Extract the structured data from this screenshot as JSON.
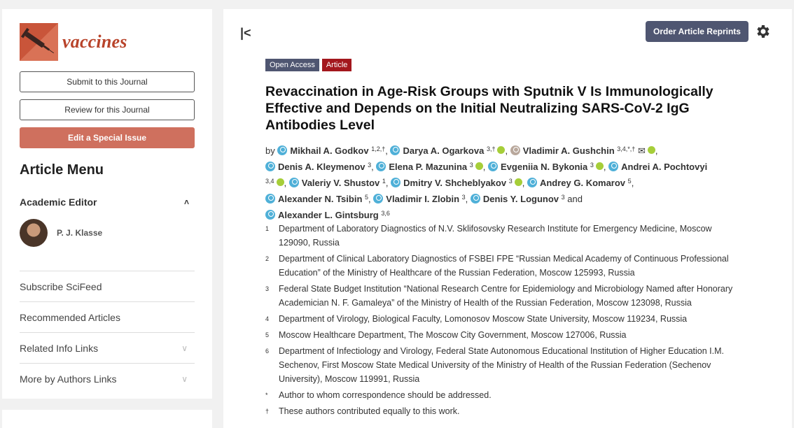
{
  "sidebar": {
    "journal_name": "vaccines",
    "buttons": {
      "submit": "Submit to this Journal",
      "review": "Review for this Journal",
      "special": "Edit a Special Issue"
    },
    "article_menu_title": "Article Menu",
    "academic_editor_label": "Academic Editor",
    "editor_name": "P. J. Klasse",
    "menu_items": [
      "Subscribe SciFeed",
      "Recommended Articles",
      "Related Info Links",
      "More by Authors Links"
    ]
  },
  "toolbar": {
    "reprints_label": "Order Article Reprints"
  },
  "article": {
    "badges": {
      "open_access": "Open Access",
      "type": "Article"
    },
    "title": "Revaccination in Age-Risk Groups with Sputnik V Is Immunologically Effective and Depends on the Initial Neutralizing SARS-CoV-2 IgG Antibodies Level",
    "by": "by",
    "and": "and",
    "authors": [
      {
        "name": "Mikhail A. Godkov",
        "sup": "1,2,†"
      },
      {
        "name": "Darya A. Ogarkova",
        "sup": "3,†"
      },
      {
        "name": "Vladimir A. Gushchin",
        "sup": "3,4,*,†"
      },
      {
        "name": "Denis A. Kleymenov",
        "sup": "3"
      },
      {
        "name": "Elena P. Mazunina",
        "sup": "3"
      },
      {
        "name": "Evgeniia N. Bykonia",
        "sup": "3"
      },
      {
        "name": "Andrei A. Pochtovyi",
        "sup": "3,4"
      },
      {
        "name": "Valeriy V. Shustov",
        "sup": "1"
      },
      {
        "name": "Dmitry V. Shcheblyakov",
        "sup": "3"
      },
      {
        "name": "Andrey G. Komarov",
        "sup": "5"
      },
      {
        "name": "Alexander N. Tsibin",
        "sup": "5"
      },
      {
        "name": "Vladimir I. Zlobin",
        "sup": "3"
      },
      {
        "name": "Denis Y. Logunov",
        "sup": "3"
      },
      {
        "name": "Alexander L. Gintsburg",
        "sup": "3,6"
      }
    ],
    "affiliations": [
      {
        "num": "1",
        "text": "Department of Laboratory Diagnostics of N.V. Sklifosovsky Research Institute for Emergency Medicine, Moscow 129090, Russia"
      },
      {
        "num": "2",
        "text": "Department of Clinical Laboratory Diagnostics of FSBEI FPE “Russian Medical Academy of Continuous Professional Education” of the Ministry of Healthcare of the Russian Federation, Moscow 125993, Russia"
      },
      {
        "num": "3",
        "text": "Federal State Budget Institution “National Research Centre for Epidemiology and Microbiology Named after Honorary Academician N. F. Gamaleya” of the Ministry of Health of the Russian Federation, Moscow 123098, Russia"
      },
      {
        "num": "4",
        "text": "Department of Virology, Biological Faculty, Lomonosov Moscow State University, Moscow 119234, Russia"
      },
      {
        "num": "5",
        "text": "Moscow Healthcare Department, The Moscow City Government, Moscow 127006, Russia"
      },
      {
        "num": "6",
        "text": "Department of Infectiology and Virology, Federal State Autonomous Educational Institution of Higher Education I.M. Sechenov, First Moscow State Medical University of the Ministry of Health of the Russian Federation (Sechenov University), Moscow 119991, Russia"
      },
      {
        "num": "*",
        "text": "Author to whom correspondence should be addressed."
      },
      {
        "num": "†",
        "text": "These authors contributed equally to this work."
      }
    ]
  }
}
